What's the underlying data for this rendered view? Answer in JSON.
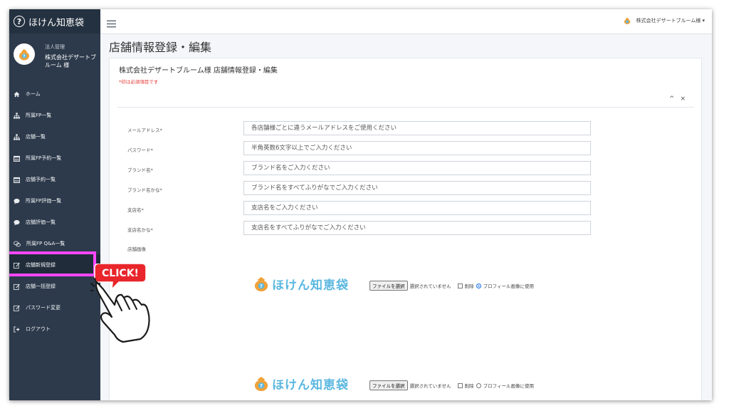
{
  "app": {
    "brand": "ほけん知恵袋"
  },
  "user": {
    "role": "法人管理",
    "name": "株式会社デザートブルーム 様",
    "top_name": "株式会社デザートブルーム様 ▾"
  },
  "sidebar": {
    "items": [
      {
        "label": "ホーム",
        "icon": "home-icon"
      },
      {
        "label": "所属FP一覧",
        "icon": "sitemap-icon"
      },
      {
        "label": "店舗一覧",
        "icon": "sitemap-icon"
      },
      {
        "label": "所属FP予約一覧",
        "icon": "calendar-icon"
      },
      {
        "label": "店舗予約一覧",
        "icon": "calendar-icon"
      },
      {
        "label": "所属FP評価一覧",
        "icon": "comment-icon"
      },
      {
        "label": "店舗評価一覧",
        "icon": "comment-icon"
      },
      {
        "label": "所属FP Q&A一覧",
        "icon": "comments-icon"
      },
      {
        "label": "店舗新規登録",
        "icon": "edit-icon"
      },
      {
        "label": "店舗一括登録",
        "icon": "edit-icon"
      },
      {
        "label": "パスワード変更",
        "icon": "edit-icon"
      },
      {
        "label": "ログアウト",
        "icon": "logout-icon"
      }
    ]
  },
  "page": {
    "title": "店舗情報登録・編集",
    "card_title": "株式会社デザートブルーム様 店舗情報登録・編集",
    "required_note": "*印は必須項目です",
    "tools": {
      "collapse": "^",
      "close": "×"
    }
  },
  "form": {
    "fields": [
      {
        "label": "メールアドレス*",
        "placeholder": "各店舗様ごとに違うメールアドレスをご使用ください"
      },
      {
        "label": "パスワード*",
        "placeholder": "半角英数6文字以上でご入力ください"
      },
      {
        "label": "ブランド名*",
        "placeholder": "ブランド名をご入力ください"
      },
      {
        "label": "ブランド名かな*",
        "placeholder": "ブランド名をすべてふりがなでご入力ください"
      },
      {
        "label": "支店名*",
        "placeholder": "支店名をご入力ください"
      },
      {
        "label": "支店名かな*",
        "placeholder": "支店名をすべてふりがなでご入力ください"
      }
    ],
    "image_label": "店舗画像",
    "image_rows": [
      {
        "logo": "ほけん知恵袋",
        "file_button": "ファイルを選択",
        "file_status": "選択されていません",
        "delete_label": "削除",
        "profile_label": "プロフィール画像に使用",
        "profile_checked": true
      },
      {
        "logo": "ほけん知恵袋",
        "file_button": "ファイルを選択",
        "file_status": "選択されていません",
        "delete_label": "削除",
        "profile_label": "プロフィール画像に使用",
        "profile_checked": false
      }
    ]
  },
  "annotation": {
    "click_label": "CLICK!",
    "highlight_color": "#ff47ff",
    "callout_color": "#e8262b"
  },
  "colors": {
    "sidebar_bg": "#2d3a4b",
    "brand_bg": "#243140",
    "logo_blue": "#5cb8e0",
    "logo_orange": "#f0a23a",
    "required_red": "#e3342f"
  }
}
